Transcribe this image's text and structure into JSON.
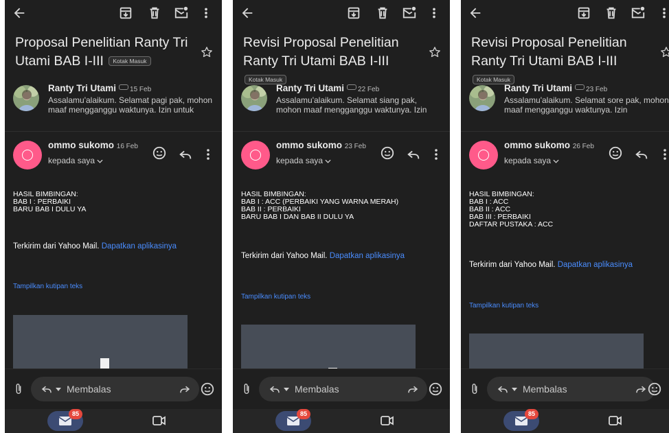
{
  "screens": [
    {
      "subject": "Proposal Penelitian Ranty Tri Utami BAB I-III",
      "label_badge": "Kotak Masuk",
      "first_message": {
        "sender": "Ranty Tri Utami",
        "date": "15 Feb",
        "snippet": "Assalamu'alaikum. Selamat pagi pak, mohon maaf mengganggu waktunya. Izin untuk"
      },
      "reply_message": {
        "sender": "ommo sukomo",
        "date": "16 Feb",
        "recipient": "kepada saya",
        "body_lines": [
          "HASIL BIMBINGAN:",
          "BAB I : PERBAIKI",
          "BARU BAB I DULU YA"
        ],
        "footer_text": "Terkirim dari Yahoo Mail.",
        "footer_link": "Dapatkan aplikasinya",
        "quote_link": "Tampilkan kutipan teks"
      }
    },
    {
      "subject": "Revisi Proposal Penelitian Ranty Tri Utami BAB I-III",
      "label_badge": "Kotak Masuk",
      "first_message": {
        "sender": "Ranty Tri Utami",
        "date": "22 Feb",
        "snippet": "Assalamu'alaikum. Selamat siang pak, mohon maaf mengganggu waktunya. Izin"
      },
      "reply_message": {
        "sender": "ommo sukomo",
        "date": "23 Feb",
        "recipient": "kepada saya",
        "body_lines": [
          "HASIL BIMBINGAN:",
          "BAB I : ACC (PERBAIKI YANG WARNA MERAH)",
          "BAB II : PERBAIKI",
          "BARU BAB I DAN BAB II DULU YA"
        ],
        "footer_text": "Terkirim dari Yahoo Mail.",
        "footer_link": "Dapatkan aplikasinya",
        "quote_link": "Tampilkan kutipan teks"
      }
    },
    {
      "subject": "Revisi Proposal Penelitian Ranty Tri Utami BAB I-III",
      "label_badge": "Kotak Masuk",
      "first_message": {
        "sender": "Ranty Tri Utami",
        "date": "23 Feb",
        "snippet": "Assalamu'alaikum. Selamat sore pak, mohon maaf mengganggu waktunya. Izin"
      },
      "reply_message": {
        "sender": "ommo sukomo",
        "date": "26 Feb",
        "recipient": "kepada saya",
        "body_lines": [
          "HASIL BIMBINGAN:",
          "BAB I : ACC",
          "BAB II : ACC",
          "BAB III : PERBAIKI",
          "DAFTAR PUSTAKA : ACC"
        ],
        "footer_text": "Terkirim dari Yahoo Mail.",
        "footer_link": "Dapatkan aplikasinya",
        "quote_link": "Tampilkan kutipan teks"
      }
    }
  ],
  "composer": {
    "reply_label": "Membalas"
  },
  "bottom_nav": {
    "mail_unread_count": "85"
  },
  "icons": [
    "back-arrow-icon",
    "archive-icon",
    "trash-icon",
    "mark-unread-icon",
    "more-vert-icon",
    "star-icon",
    "emoji-icon",
    "reply-icon",
    "attachment-icon",
    "forward-icon",
    "mail-icon",
    "video-icon",
    "label-icon",
    "file-icon"
  ],
  "colors": {
    "background": "#1f1f1f",
    "avatar_pink": "#ff5a8a",
    "link_blue": "#4a8dff",
    "badge_red": "#e5483d",
    "mail_pill": "#3c4b73"
  }
}
